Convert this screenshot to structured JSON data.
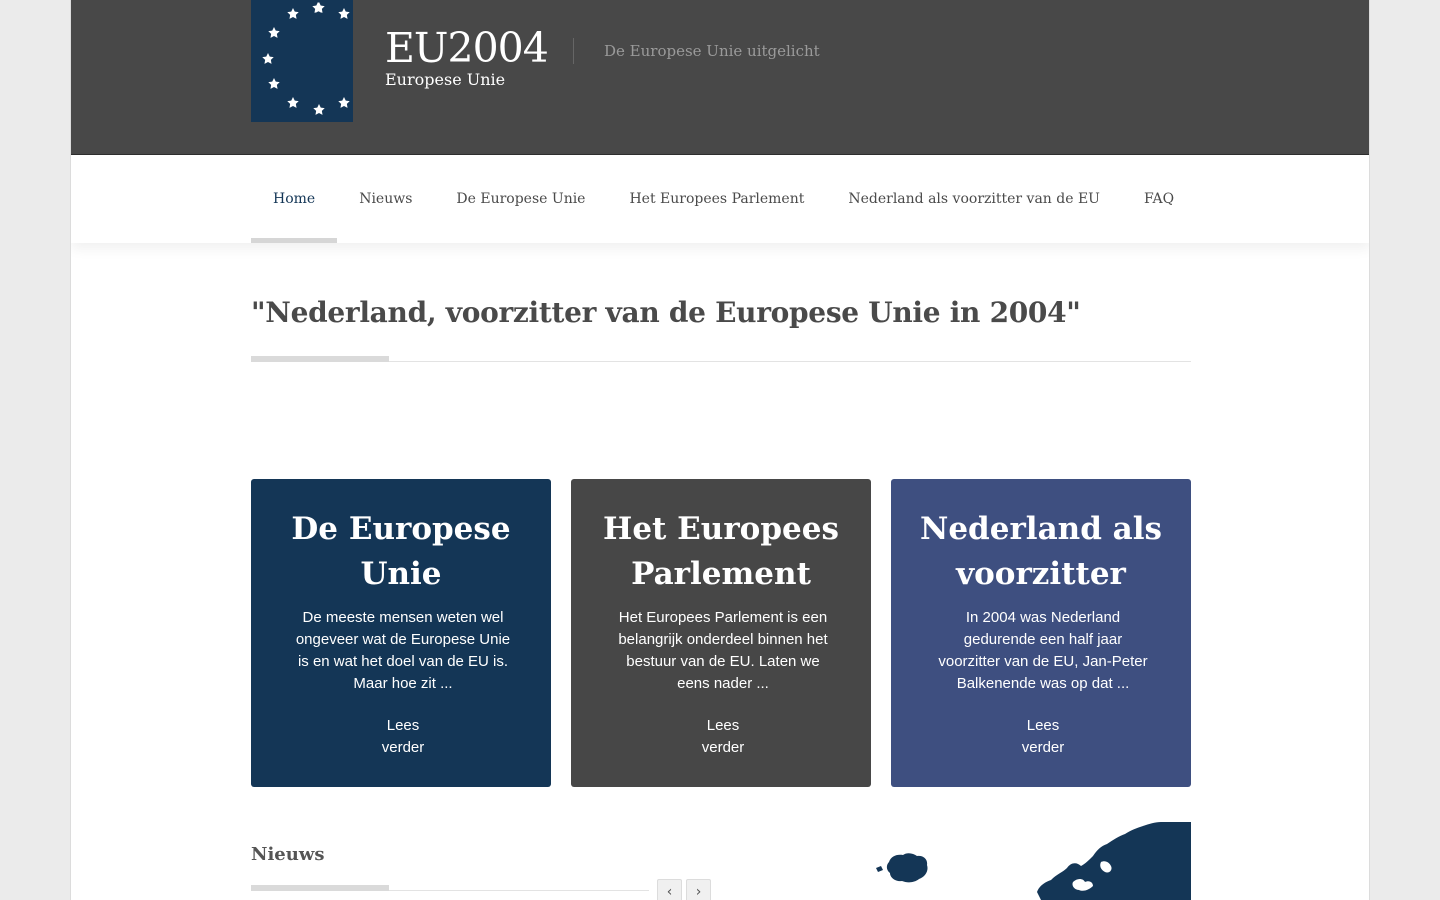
{
  "site": {
    "logo_title": "EU2004",
    "logo_subtitle": "Europese Unie",
    "tagline": "De Europese Unie uitgelicht"
  },
  "nav": {
    "items": [
      {
        "label": "Home",
        "active": true
      },
      {
        "label": "Nieuws"
      },
      {
        "label": "De Europese Unie"
      },
      {
        "label": "Het Europees Parlement"
      },
      {
        "label": "Nederland als voorzitter van de EU"
      },
      {
        "label": "FAQ"
      }
    ]
  },
  "main": {
    "heading": "\"Nederland, voorzitter van de Europese Unie in 2004\""
  },
  "cards": [
    {
      "title_line1": "De Europese",
      "title_line2": "Unie",
      "text": "De meeste mensen weten wel ongeveer wat de Europese Unie is en wat het doel van de EU is. Maar hoe zit ...",
      "link_line1": "Lees",
      "link_line2": "verder",
      "color": "#143656"
    },
    {
      "title_line1": "Het Europees",
      "title_line2": "Parlement",
      "text": "Het Europees Parlement is een belangrijk onderdeel binnen het bestuur van de EU. Laten we eens nader ...",
      "link_line1": "Lees",
      "link_line2": "verder",
      "color": "#474747"
    },
    {
      "title_line1": "Nederland als",
      "title_line2": "voorzitter",
      "text": "In 2004 was Nederland gedurende een half jaar voorzitter van de EU, Jan-Peter Balkenende was op dat ...",
      "link_line1": "Lees",
      "link_line2": "verder",
      "color": "#3e4f80"
    }
  ],
  "news": {
    "title": "Nieuws",
    "prev_icon": "chevron-left-icon",
    "next_icon": "chevron-right-icon",
    "prev_glyph": "‹",
    "next_glyph": "›"
  },
  "colors": {
    "header_bg": "#484848",
    "brand_blue": "#143656",
    "map_blue": "#143656"
  }
}
